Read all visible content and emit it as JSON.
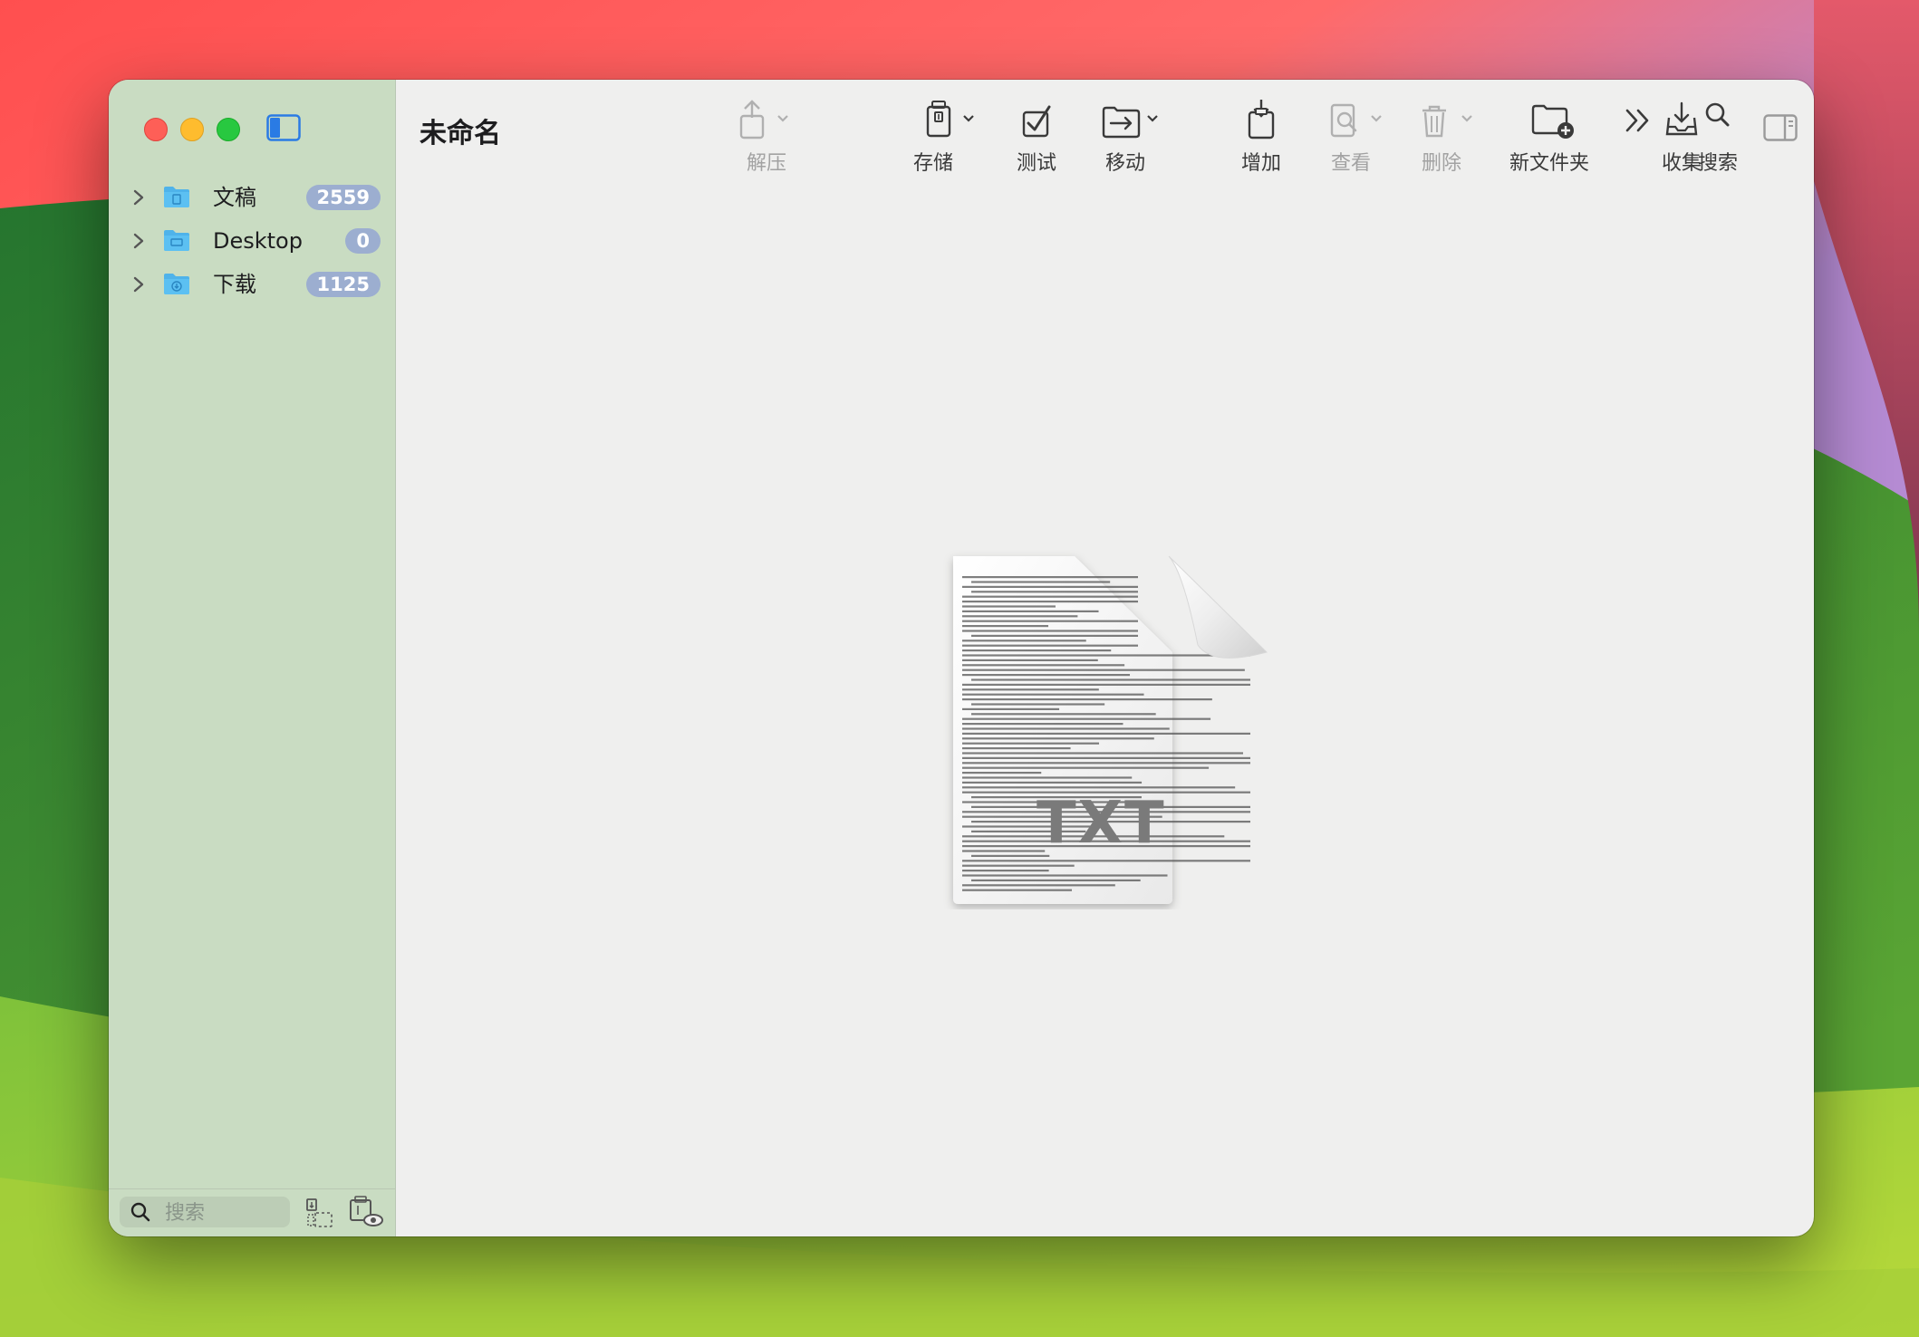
{
  "window": {
    "title": "未命名"
  },
  "toolbar": {
    "items": [
      {
        "id": "extract",
        "label": "解压",
        "icon": "extract-icon",
        "enabled": false
      },
      {
        "id": "save",
        "label": "存储",
        "icon": "archive-save-icon",
        "enabled": true
      },
      {
        "id": "test",
        "label": "测试",
        "icon": "checkmark-icon",
        "enabled": true
      },
      {
        "id": "move",
        "label": "移动",
        "icon": "move-icon",
        "enabled": true
      },
      {
        "id": "add",
        "label": "增加",
        "icon": "add-file-icon",
        "enabled": true
      },
      {
        "id": "view",
        "label": "查看",
        "icon": "view-icon",
        "enabled": false
      },
      {
        "id": "delete",
        "label": "删除",
        "icon": "trash-icon",
        "enabled": false
      },
      {
        "id": "newfolder",
        "label": "新文件夹",
        "icon": "new-folder-icon",
        "enabled": true
      },
      {
        "id": "collect",
        "label": "收集",
        "icon": "collect-icon",
        "enabled": true
      },
      {
        "id": "search",
        "label": "搜索",
        "icon": "search-icon",
        "enabled": true
      }
    ]
  },
  "sidebar": {
    "items": [
      {
        "name": "文稿",
        "count": "2559",
        "icon": "documents-folder-icon"
      },
      {
        "name": "Desktop",
        "count": "0",
        "icon": "desktop-folder-icon"
      },
      {
        "name": "下载",
        "count": "1125",
        "icon": "downloads-folder-icon"
      }
    ],
    "search_placeholder": "搜索"
  },
  "preview": {
    "file_type_label": "TXT"
  },
  "colors": {
    "sidebar_bg": "#c9dcc2",
    "badge_bg": "#9caed0",
    "folder_blue": "#4fb3ea",
    "content_bg": "#efefee"
  }
}
